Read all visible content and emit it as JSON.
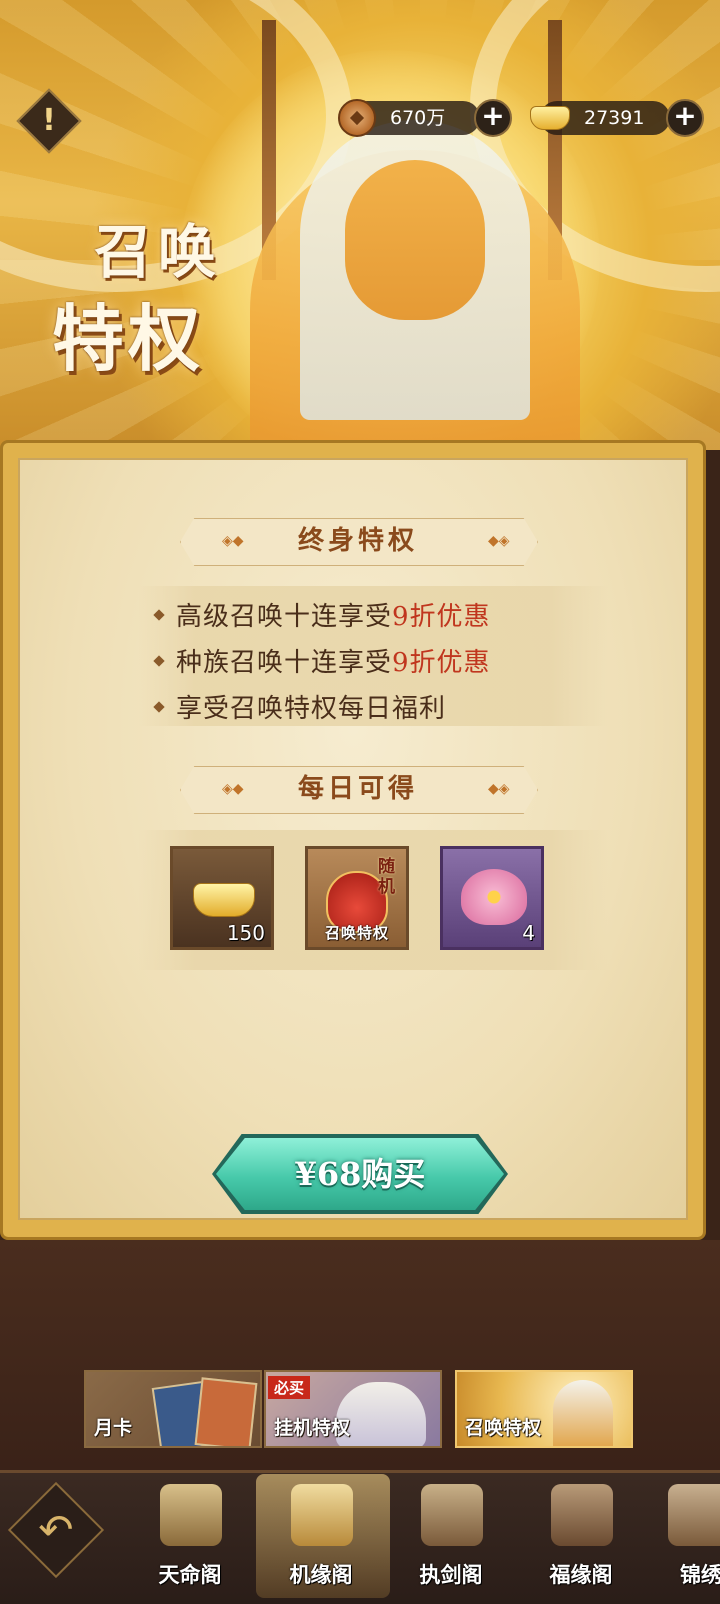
{
  "header": {
    "title_line1": "召唤",
    "title_line2": "特权",
    "info_icon": "!",
    "currencies": [
      {
        "icon": "copper-coin-icon",
        "value": "670万"
      },
      {
        "icon": "gold-ingot-icon",
        "value": "27391"
      }
    ],
    "plus_icon": "+"
  },
  "panel": {
    "lifetime_section_title": "终身特权",
    "perks": [
      {
        "text": "高级召唤十连享受",
        "highlight": "9折优惠"
      },
      {
        "text": "种族召唤十连享受",
        "highlight": "9折优惠"
      },
      {
        "text": "享受召唤特权每日福利",
        "highlight": ""
      }
    ],
    "daily_section_title": "每日可得",
    "daily_items": [
      {
        "icon": "gold-ingot-icon",
        "count": "150"
      },
      {
        "icon": "red-lucky-bag-icon",
        "label": "召唤特权",
        "tag": "随机"
      },
      {
        "icon": "pink-lotus-icon",
        "count": "4"
      }
    ],
    "buy_button": "¥68购买"
  },
  "subtabs": [
    {
      "label": "月卡"
    },
    {
      "label": "挂机特权",
      "badge": "必买"
    },
    {
      "label": "召唤特权",
      "active": true
    }
  ],
  "bottom_nav": {
    "back_icon": "↶",
    "items": [
      {
        "label": "天命阁"
      },
      {
        "label": "机缘阁",
        "active": true
      },
      {
        "label": "执剑阁"
      },
      {
        "label": "福缘阁"
      },
      {
        "label": "锦绣"
      }
    ]
  },
  "colors": {
    "highlight_red": "#c0361e",
    "buy_button_teal": "#47c9aa",
    "gold_frame": "#e0b24c"
  }
}
